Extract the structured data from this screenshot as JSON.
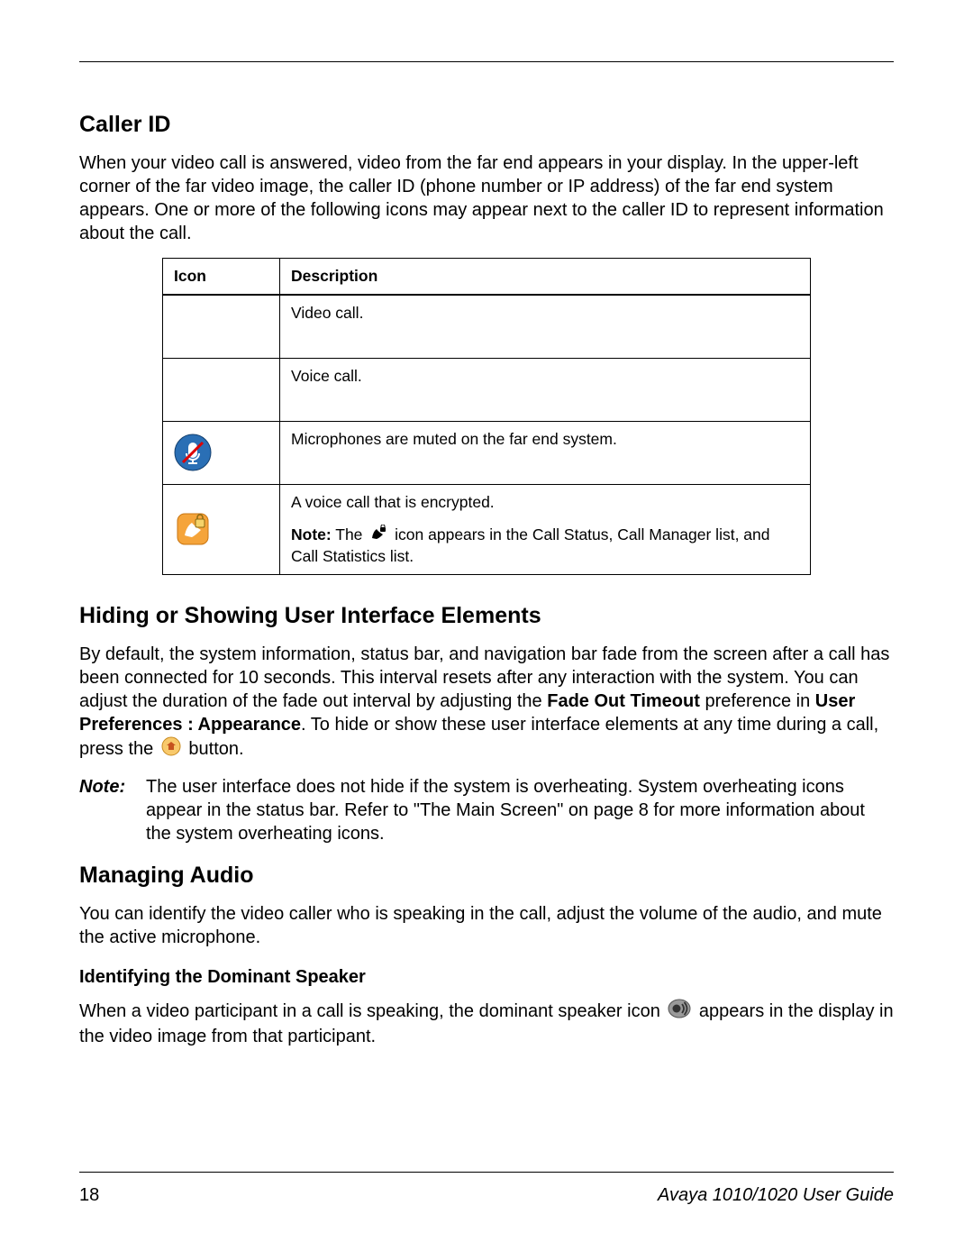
{
  "sections": {
    "callerId": {
      "heading": "Caller ID",
      "para": "When your video call is answered, video from the far end appears in your display. In the upper-left corner of the far video image, the caller ID (phone number or IP address) of the far end system appears. One or more of the following icons may appear next to the caller ID to represent information about the call."
    },
    "table": {
      "headerIcon": "Icon",
      "headerDesc": "Description",
      "rows": [
        {
          "desc": "Video call."
        },
        {
          "desc": "Voice call."
        },
        {
          "desc": "Microphones are muted on the far end system."
        },
        {
          "desc": "A voice call that is encrypted.",
          "noteLabel": "Note:",
          "noteRest1": " The ",
          "noteRest2": " icon appears in the Call Status, Call Manager list, and Call Statistics list."
        }
      ]
    },
    "hiding": {
      "heading": "Hiding or Showing User Interface Elements",
      "para1a": "By default, the system information, status bar, and navigation bar fade from the screen after a call has been connected for 10 seconds. This interval resets after any interaction with the system. You can adjust the duration of the fade out interval by adjusting the ",
      "bold1": "Fade Out Timeout",
      "para1b": " preference in ",
      "bold2": "User Preferences : Appearance",
      "para1c": ". To hide or show these user interface elements at any time during a call, press the ",
      "para1d": " button.",
      "noteLabel": "Note:",
      "noteBody": "The user interface does not hide if the system is overheating. System overheating icons appear in the status bar. Refer to \"The Main Screen\" on page 8 for more information about the system overheating icons."
    },
    "audio": {
      "heading": "Managing Audio",
      "para": "You can identify the video caller who is speaking in the call, adjust the volume of the audio, and mute the active microphone.",
      "sub": "Identifying the Dominant Speaker",
      "subParaA": "When a video participant in a call is speaking, the dominant speaker icon ",
      "subParaB": " appears in the display in the video image from that participant."
    }
  },
  "footer": {
    "page": "18",
    "title": "Avaya 1010/1020 User Guide"
  }
}
